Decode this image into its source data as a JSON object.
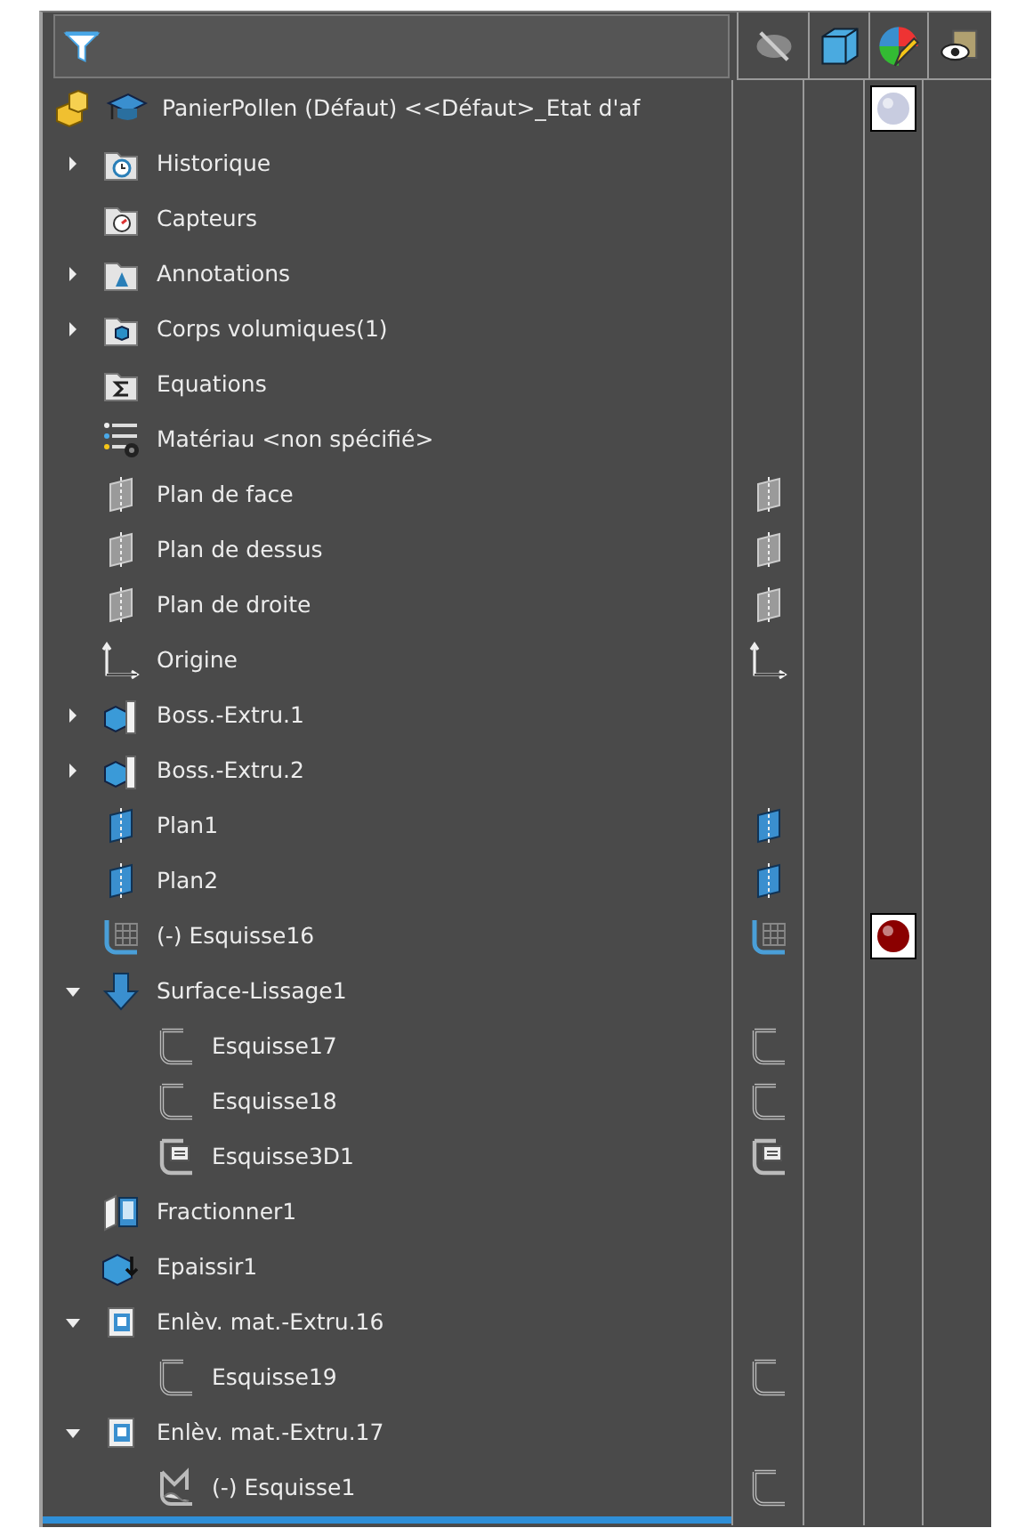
{
  "columns": [
    {
      "kind": "hide"
    },
    {
      "kind": "display"
    },
    {
      "kind": "appearance"
    },
    {
      "kind": "visibility"
    }
  ],
  "part": {
    "label": "PanierPollen (Défaut) <<Défaut>_Etat d'af",
    "color": "#c8cce0"
  },
  "features": [
    {
      "label": "Historique",
      "kind": "history",
      "expanded": false
    },
    {
      "label": "Capteurs",
      "kind": "sensor"
    },
    {
      "label": "Annotations",
      "kind": "annotations",
      "expanded": false
    },
    {
      "label": "Corps volumiques(1)",
      "kind": "bodies",
      "expanded": false
    },
    {
      "label": "Equations",
      "kind": "equations"
    },
    {
      "label": "Matériau <non spécifié>",
      "kind": "material"
    },
    {
      "label": "Plan de face",
      "kind": "plane",
      "shown": true
    },
    {
      "label": "Plan de dessus",
      "kind": "plane",
      "shown": true
    },
    {
      "label": "Plan de droite",
      "kind": "plane",
      "shown": true
    },
    {
      "label": "Origine",
      "kind": "origin",
      "shown": true
    },
    {
      "label": "Boss.-Extru.1",
      "kind": "extrude",
      "expanded": false
    },
    {
      "label": "Boss.-Extru.2",
      "kind": "extrude",
      "expanded": false
    },
    {
      "label": "Plan1",
      "kind": "plane_ref",
      "shown": true
    },
    {
      "label": "Plan2",
      "kind": "plane_ref",
      "shown": true
    },
    {
      "label": "(-) Esquisse16",
      "kind": "sketch_grid",
      "shown": true,
      "color": "#8b0000"
    },
    {
      "label": "Surface-Lissage1",
      "kind": "loft",
      "expanded": true,
      "children": [
        {
          "label": "Esquisse17",
          "kind": "sketch",
          "shown": true
        },
        {
          "label": "Esquisse18",
          "kind": "sketch",
          "shown": true
        },
        {
          "label": "Esquisse3D1",
          "kind": "sketch3d",
          "shown": true
        }
      ]
    },
    {
      "label": "Fractionner1",
      "kind": "split"
    },
    {
      "label": "Epaissir1",
      "kind": "thicken"
    },
    {
      "label": "Enlèv. mat.-Extru.16",
      "kind": "cut",
      "expanded": true,
      "children": [
        {
          "label": "Esquisse19",
          "kind": "sketch",
          "shown": true
        }
      ]
    },
    {
      "label": "Enlèv. mat.-Extru.17",
      "kind": "cut",
      "expanded": true,
      "children": [
        {
          "label": "(-) Esquisse1",
          "kind": "sketch_hand",
          "shown": true
        }
      ]
    }
  ]
}
